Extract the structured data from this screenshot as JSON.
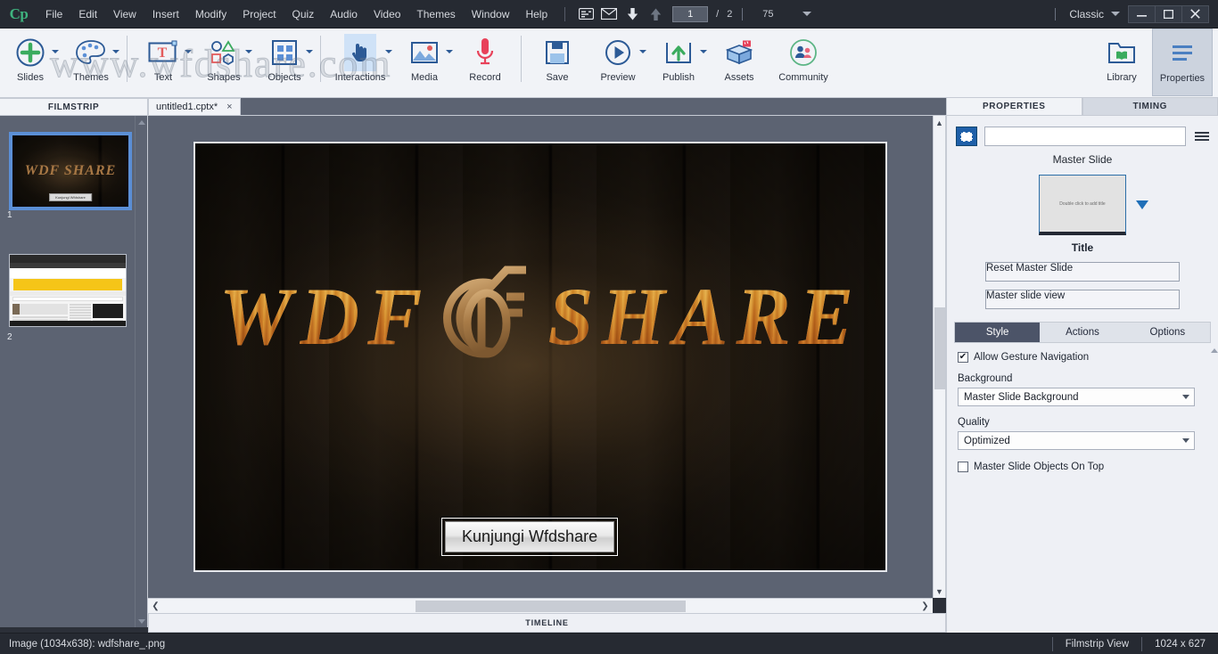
{
  "app": {
    "logo": "Cp",
    "workspace": "Classic"
  },
  "menubar": {
    "items": [
      "File",
      "Edit",
      "View",
      "Insert",
      "Modify",
      "Project",
      "Quiz",
      "Audio",
      "Video",
      "Themes",
      "Window",
      "Help"
    ],
    "icons": [
      "closed-captioning-icon",
      "mail-icon",
      "arrow-down-icon",
      "arrow-up-icon"
    ],
    "page_current": "1",
    "page_separator": "/",
    "page_total": "2",
    "zoom": "75",
    "window_controls": [
      "minimize",
      "maximize",
      "close"
    ]
  },
  "toolbar": {
    "watermark": "www.wfdshare.com",
    "items": [
      {
        "label": "Slides",
        "icon": "plus-circle-icon",
        "has_dropdown": true
      },
      {
        "label": "Themes",
        "icon": "palette-icon",
        "has_dropdown": true
      },
      {
        "label": "Text",
        "icon": "text-box-icon",
        "has_dropdown": true
      },
      {
        "label": "Shapes",
        "icon": "shapes-icon",
        "has_dropdown": true
      },
      {
        "label": "Objects",
        "icon": "grid-objects-icon",
        "has_dropdown": true
      },
      {
        "label": "Interactions",
        "icon": "hand-pointer-icon",
        "has_dropdown": true
      },
      {
        "label": "Media",
        "icon": "image-icon",
        "has_dropdown": true
      },
      {
        "label": "Record",
        "icon": "microphone-icon",
        "has_dropdown": false
      },
      {
        "label": "Save",
        "icon": "floppy-disk-icon",
        "has_dropdown": false
      },
      {
        "label": "Preview",
        "icon": "play-circle-icon",
        "has_dropdown": true
      },
      {
        "label": "Publish",
        "icon": "upload-box-icon",
        "has_dropdown": true
      },
      {
        "label": "Assets",
        "icon": "open-box-icon",
        "has_dropdown": false
      },
      {
        "label": "Community",
        "icon": "people-circle-icon",
        "has_dropdown": false
      }
    ],
    "right_items": [
      {
        "label": "Library",
        "icon": "folder-book-icon"
      },
      {
        "label": "Properties",
        "icon": "lines-panel-icon"
      }
    ]
  },
  "filmstrip": {
    "header": "FILMSTRIP",
    "slides": [
      {
        "number": "1",
        "selected": true,
        "kind": "logo-slide",
        "logo_text": "WDF SHARE",
        "button_label": "Kunjungi Wfdshare"
      },
      {
        "number": "2",
        "selected": false,
        "kind": "website-screenshot"
      }
    ]
  },
  "document": {
    "tab_title": "untitled1.cptx*",
    "close_label": "×"
  },
  "canvas": {
    "slide": {
      "logo_left": "WDF",
      "logo_right": "SHARE",
      "logo_mark": "df-monogram-icon",
      "button_label": "Kunjungi Wfdshare"
    },
    "timeline_label": "TIMELINE"
  },
  "properties": {
    "tabs": [
      {
        "label": "PROPERTIES",
        "active": true
      },
      {
        "label": "TIMING",
        "active": false
      }
    ],
    "name_value": "",
    "section_label": "Master Slide",
    "master_thumb_placeholder": "Double click to add title",
    "master_title": "Title",
    "buttons": [
      {
        "label": "Reset Master Slide"
      },
      {
        "label": "Master slide view"
      }
    ],
    "sub_tabs": [
      {
        "label": "Style",
        "selected": true
      },
      {
        "label": "Actions",
        "selected": false
      },
      {
        "label": "Options",
        "selected": false
      }
    ],
    "gesture_checkbox": {
      "label": "Allow Gesture Navigation",
      "checked": true,
      "mark": "✔"
    },
    "background_label": "Background",
    "background_value": "Master Slide Background",
    "quality_label": "Quality",
    "quality_value": "Optimized",
    "objects_on_top": {
      "label": "Master Slide Objects On Top",
      "checked": false
    }
  },
  "statusbar": {
    "left": "Image (1034x638): wdfshare_.png",
    "view_mode": "Filmstrip View",
    "dimensions": "1024 x 627"
  },
  "colors": {
    "chrome_dark": "#262a32",
    "toolbar_bg": "#f1f3f7",
    "panel_bg": "#eef0f5",
    "canvas_bg": "#5c6372",
    "accent_blue": "#1e5fa8",
    "selection_blue": "#5b8fd6",
    "logo_green": "#3fb37f",
    "wood_tan": "#a87b47"
  }
}
